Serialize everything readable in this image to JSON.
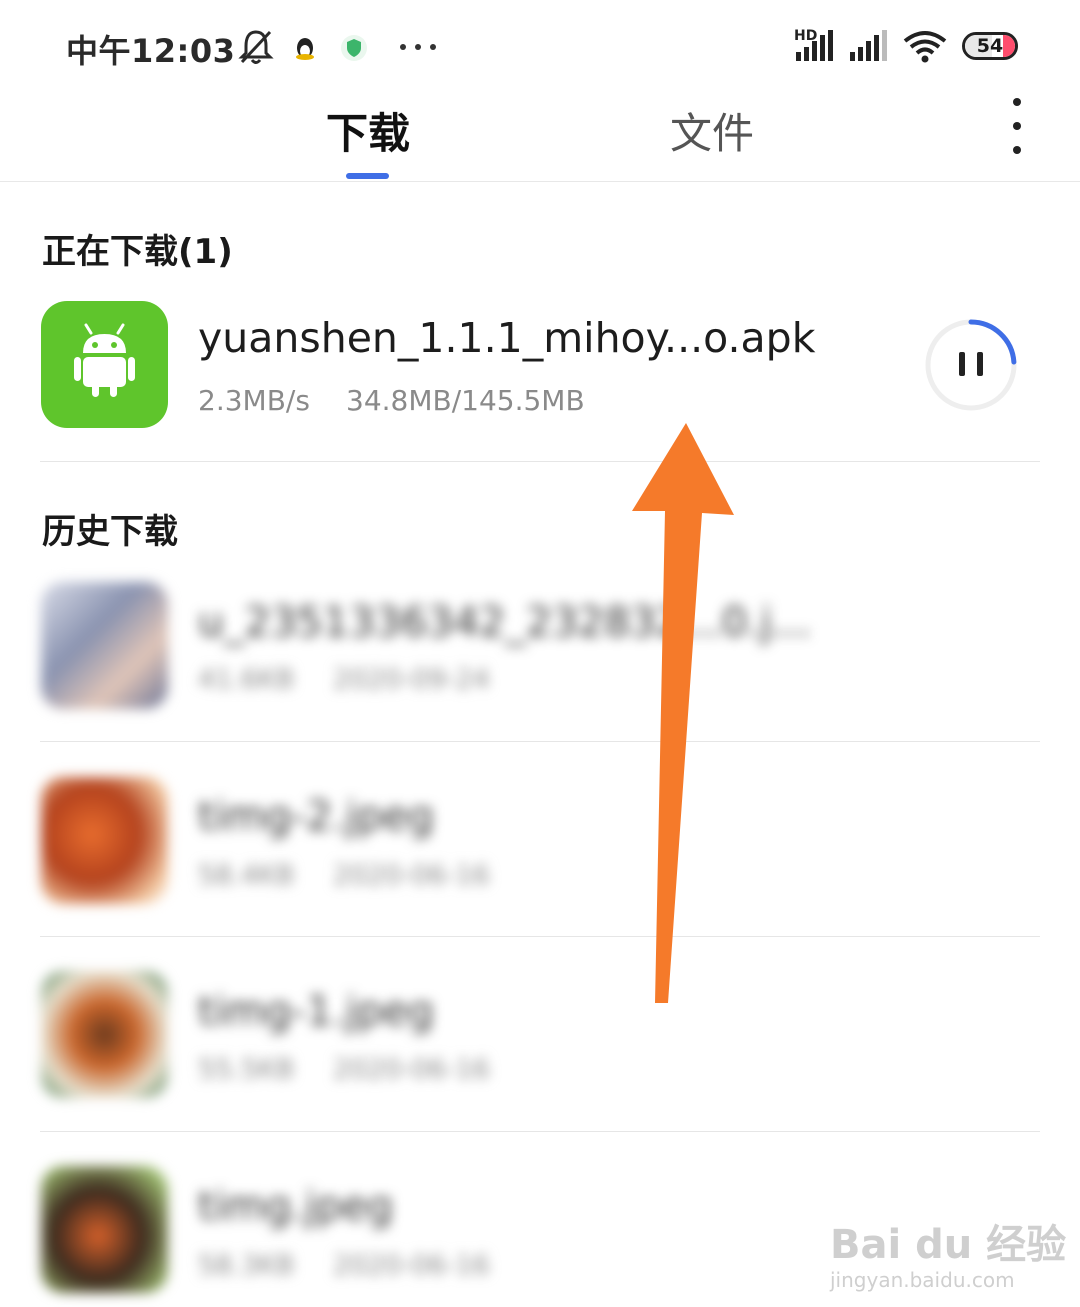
{
  "status_bar": {
    "time": "中午12:03",
    "network_label": "HD",
    "battery": "54",
    "battery_level": 0.54,
    "icons": [
      "bell-off-icon",
      "qq-penguin-icon",
      "shield-app-icon",
      "more-dots-icon",
      "signal-icon",
      "signal-icon",
      "wifi-icon",
      "battery-icon"
    ]
  },
  "tabs": [
    {
      "label": "下载",
      "active": true
    },
    {
      "label": "文件",
      "active": false
    }
  ],
  "header": {
    "menu_icon": "more-vertical-icon"
  },
  "downloading": {
    "title": "正在下载(1)",
    "item": {
      "name": "yuanshen_1.1.1_mihoy...o.apk",
      "speed": "2.3MB/s",
      "progress": "34.8MB/145.5MB",
      "progress_fraction": 0.239,
      "icon": "android-icon",
      "icon_color": "#5fc52c",
      "action_icon": "pause-icon",
      "progress_color": "#3f6ee6"
    }
  },
  "history": {
    "title": "历史下载",
    "items": [
      {
        "name": "u_2351336342_232832...0.j...",
        "size": "41.6KB",
        "date": "2020-09-24"
      },
      {
        "name": "timg-2.jpeg",
        "size": "58.4KB",
        "date": "2020-06-16"
      },
      {
        "name": "timg-1.jpeg",
        "size": "55.5KB",
        "date": "2020-06-16"
      },
      {
        "name": "timg.jpeg",
        "size": "58.3KB",
        "date": "2020-06-16"
      }
    ]
  },
  "annotation": {
    "arrow_color": "#f57a2a",
    "arrow_icon": "orange-arrow-icon"
  },
  "watermark": {
    "logo": "Bai du 经验",
    "url": "jingyan.baidu.com"
  }
}
